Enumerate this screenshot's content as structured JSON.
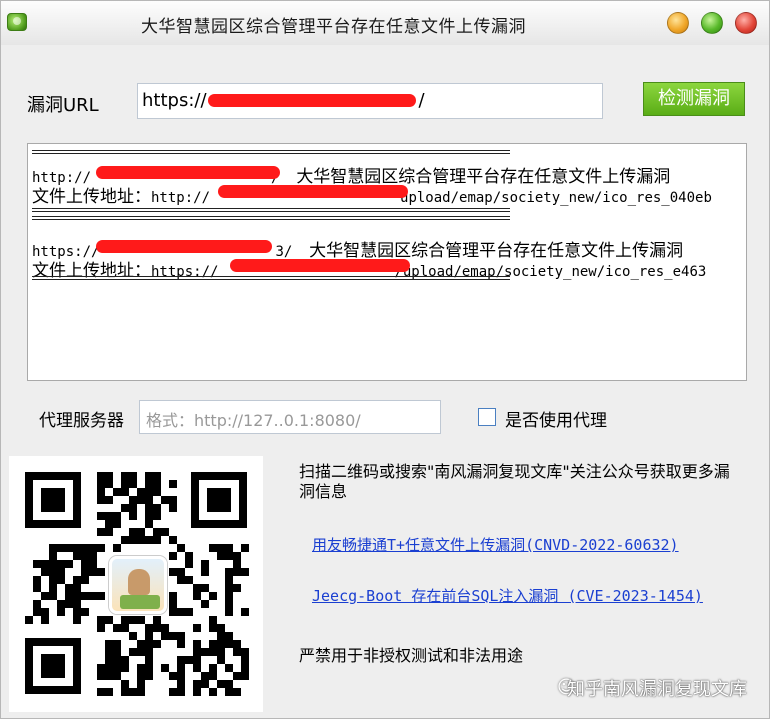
{
  "window": {
    "title": "大华智慧园区综合管理平台存在任意文件上传漏洞"
  },
  "url_row": {
    "label": "漏洞URL",
    "value_prefix": "https://",
    "value_suffix": "/",
    "check_button": "检测漏洞"
  },
  "output": {
    "results": [
      {
        "url_prefix": "http://",
        "url_suffix": "/",
        "title": "大华智慧园区综合管理平台存在任意文件上传漏洞",
        "upload_label": "文件上传地址：",
        "upload_prefix": "http://",
        "upload_suffix": "upload/emap/society_new/ico_res_040eb"
      },
      {
        "url_prefix": "https://",
        "url_suffix": "3/",
        "title": "大华智慧园区综合管理平台存在任意文件上传漏洞",
        "upload_label": "文件上传地址：",
        "upload_prefix": "https://",
        "upload_suffix": "/upload/emap/society_new/ico_res_e463"
      }
    ]
  },
  "proxy": {
    "label": "代理服务器",
    "placeholder": "格式：http://127..0.1:8080/",
    "use_proxy_label": "是否使用代理"
  },
  "info": {
    "scan_text": "扫描二维码或搜索\"南风漏洞复现文库\"关注公众号获取更多漏洞信息",
    "links": [
      "用友畅捷通T+任意文件上传漏洞(CNVD-2022-60632)",
      "Jeecg-Boot 存在前台SQL注入漏洞 (CVE-2023-1454)"
    ],
    "warning": "严禁用于非授权测试和非法用途",
    "watermark": "知乎南风漏洞复现文库"
  },
  "colors": {
    "check_button": "#5aad16",
    "redaction": "#ff1a1a",
    "link": "#1a3fd1"
  }
}
